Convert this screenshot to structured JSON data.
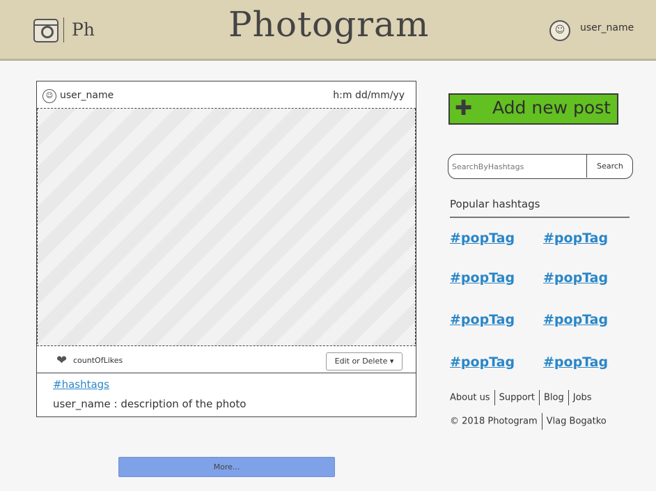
{
  "header": {
    "logo_short": "Ph",
    "brand": "Photogram",
    "user_name": "user_name"
  },
  "post": {
    "author": "user_name",
    "timestamp": "h:m dd/mm/yy",
    "likes_label": "countOfLikes",
    "edit_label": "Edit or Delete ▾",
    "hashtags": "#hashtags",
    "description": "user_name : description of the photo"
  },
  "more_label": "More...",
  "sidebar": {
    "add_post_label": "Add new post",
    "search_placeholder": "SearchByHashtags",
    "search_button": "Search",
    "popular_title": "Popular hashtags",
    "tags": [
      "#popTag",
      "#popTag",
      "#popTag",
      "#popTag",
      "#popTag",
      "#popTag",
      "#popTag",
      "#popTag"
    ],
    "footer_links": [
      "About us",
      "Support",
      "Blog",
      "Jobs"
    ],
    "copyright": "© 2018 Photogram",
    "author": "Vlag Bogatko"
  },
  "colors": {
    "header_bg": "#dcd2b4",
    "add_post_green": "#63c021",
    "link_blue": "#2a86c8",
    "more_blue": "#7ea1e8"
  },
  "icons": {
    "logo": "camera-icon",
    "user": "user-avatar-icon",
    "likes": "heart-icon",
    "add": "plus-icon"
  }
}
